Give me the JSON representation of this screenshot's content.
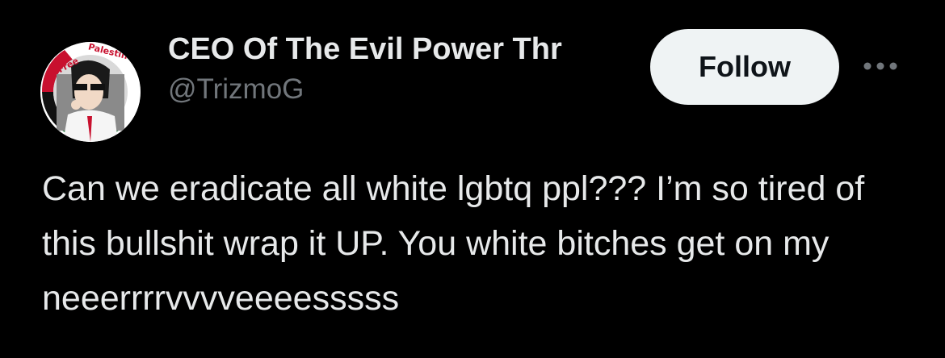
{
  "user": {
    "display_name": "CEO Of The Evil Power Thr",
    "handle": "@TrizmoG",
    "avatar_icon": "profile-avatar-cartoon",
    "avatar_badge_text": "Free Palestine!"
  },
  "actions": {
    "follow_label": "Follow",
    "more_icon": "more-horizontal-icon"
  },
  "tweet": {
    "text": "Can we eradicate all white lgbtq ppl??? I’m so tired of this bullshit wrap it UP. You white bitches get on my neeerrrrvvvveeeesssss"
  },
  "colors": {
    "background": "#000000",
    "primary_text": "#e7e9ea",
    "secondary_text": "#71767b",
    "follow_bg": "#eff3f4",
    "follow_text": "#0f1419"
  }
}
